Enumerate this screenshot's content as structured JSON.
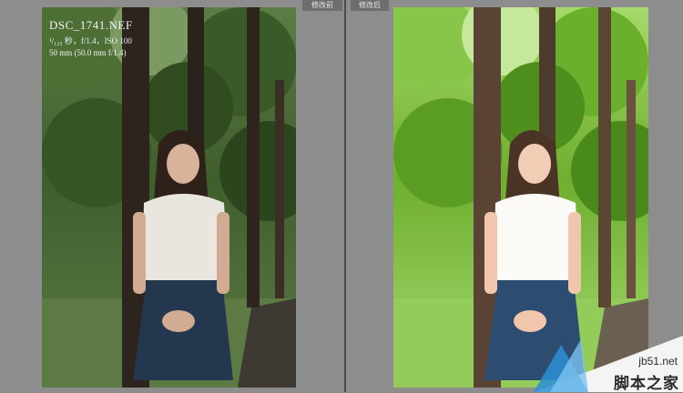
{
  "labels": {
    "before": "修改前",
    "after": "修改后"
  },
  "photo_info": {
    "filename": "DSC_1741.NEF",
    "exposure": "¹/₁₂₅ 秒，f/1.4，ISO 100",
    "lens": "50 mm (50.0 mm f/1.4)"
  },
  "watermark": {
    "url": "jb51.net",
    "name": "脚本之家",
    "accent": "#2b8fd6"
  },
  "colors": {
    "pane_bg": "#8d8d8d",
    "before_tone": "#3e5a2c",
    "after_tone": "#7fc03a"
  }
}
